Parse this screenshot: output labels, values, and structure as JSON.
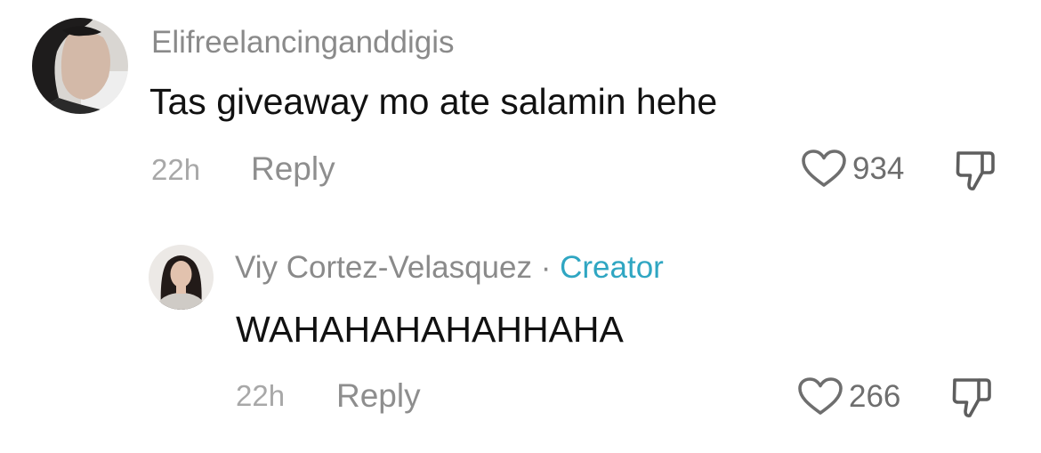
{
  "comments": [
    {
      "username": "Elifreelancinganddigis",
      "text": "Tas giveaway mo ate salamin hehe",
      "time": "22h",
      "reply_label": "Reply",
      "likes": "934"
    }
  ],
  "replies": [
    {
      "username": "Viy Cortez-Velasquez",
      "separator": "·",
      "badge": "Creator",
      "text": "WAHAHAHAHAHHAHA",
      "time": "22h",
      "reply_label": "Reply",
      "likes": "266"
    }
  ],
  "colors": {
    "creator_badge": "#2fa6c2",
    "username": "#8a8a8a",
    "comment_text": "#111111",
    "meta_text": "#a8a8a8"
  },
  "icons": {
    "like": "heart-outline-icon",
    "dislike": "thumbs-down-outline-icon"
  }
}
